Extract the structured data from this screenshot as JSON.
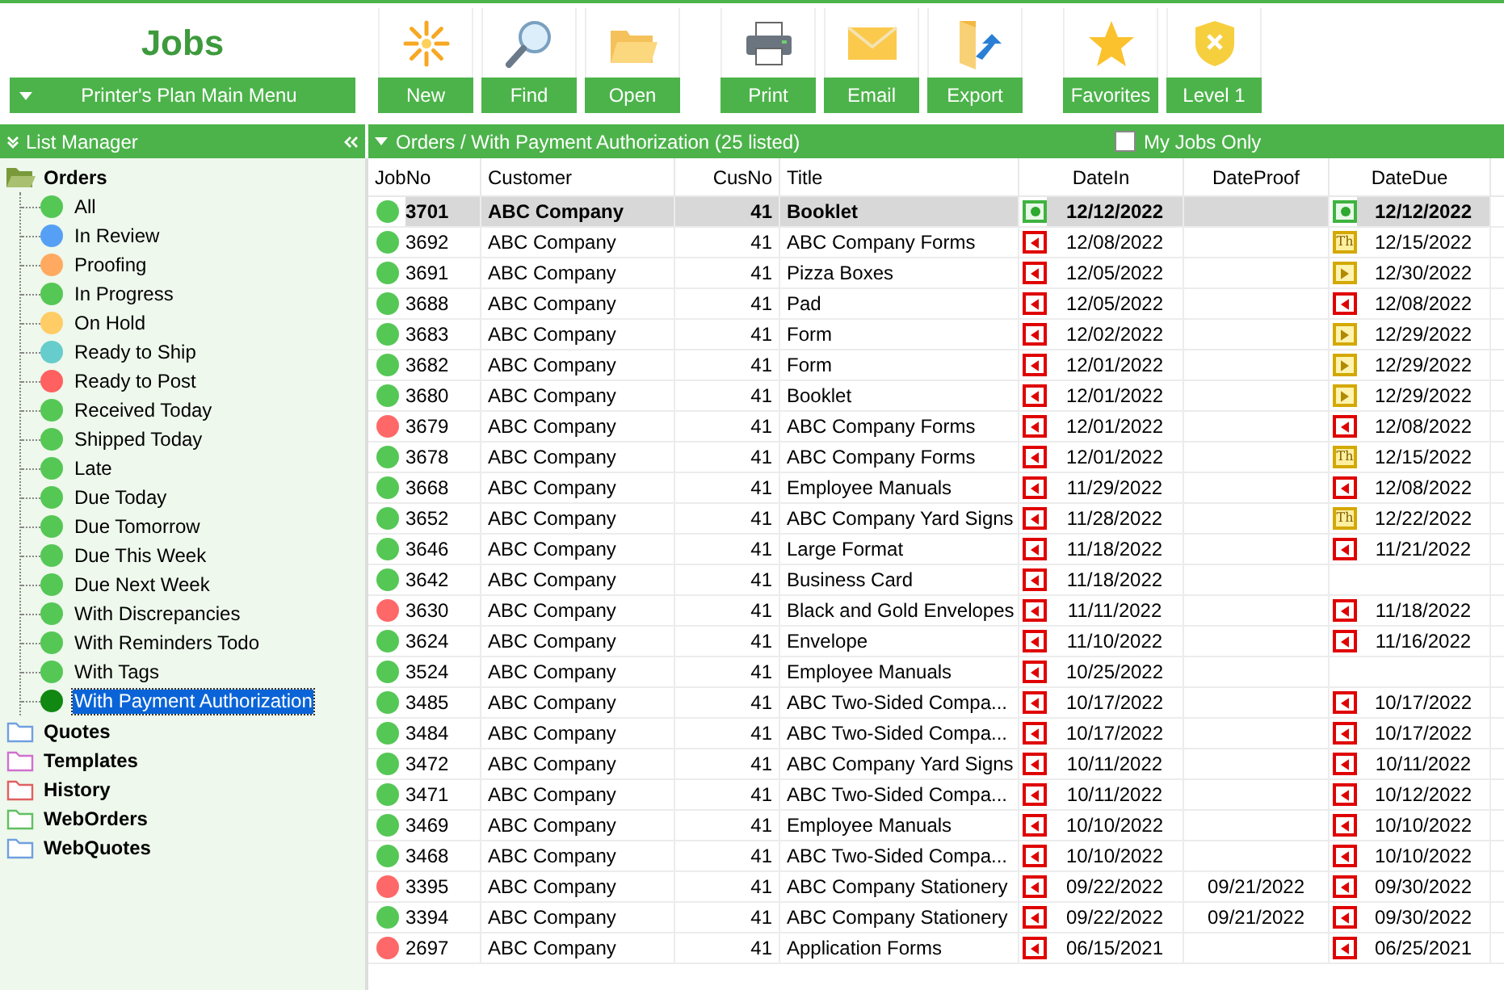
{
  "header": {
    "title": "Jobs",
    "menu": "Printer's Plan Main Menu"
  },
  "toolbar": [
    {
      "label": "New"
    },
    {
      "label": "Find"
    },
    {
      "label": "Open"
    },
    {
      "label": "Print"
    },
    {
      "label": "Email"
    },
    {
      "label": "Export"
    },
    {
      "label": "Favorites"
    },
    {
      "label": "Level 1"
    }
  ],
  "sidebar": {
    "title": "List Manager",
    "folders": [
      {
        "label": "Orders",
        "color": "#7a9a3a",
        "expanded": true,
        "children": [
          {
            "label": "All",
            "color": "#55c755",
            "selected": false
          },
          {
            "label": "In Review",
            "color": "#55a0f5",
            "selected": false
          },
          {
            "label": "Proofing",
            "color": "#ffaa60",
            "selected": false
          },
          {
            "label": "In Progress",
            "color": "#55c755",
            "selected": false
          },
          {
            "label": "On Hold",
            "color": "#ffcc66",
            "selected": false
          },
          {
            "label": "Ready to Ship",
            "color": "#66cccc",
            "selected": false
          },
          {
            "label": "Ready to Post",
            "color": "#ff6060",
            "selected": false
          },
          {
            "label": "Received Today",
            "color": "#55c755",
            "selected": false
          },
          {
            "label": "Shipped Today",
            "color": "#55c755",
            "selected": false
          },
          {
            "label": "Late",
            "color": "#55c755",
            "selected": false
          },
          {
            "label": "Due Today",
            "color": "#55c755",
            "selected": false
          },
          {
            "label": "Due Tomorrow",
            "color": "#55c755",
            "selected": false
          },
          {
            "label": "Due This Week",
            "color": "#55c755",
            "selected": false
          },
          {
            "label": "Due Next Week",
            "color": "#55c755",
            "selected": false
          },
          {
            "label": "With Discrepancies",
            "color": "#55c755",
            "selected": false
          },
          {
            "label": "With Reminders Todo",
            "color": "#55c755",
            "selected": false
          },
          {
            "label": "With Tags",
            "color": "#55c755",
            "selected": false
          },
          {
            "label": "With Payment Authorization",
            "color": "#118811",
            "selected": true
          }
        ]
      },
      {
        "label": "Quotes",
        "color": "#6fa0e0",
        "expanded": false
      },
      {
        "label": "Templates",
        "color": "#d070d0",
        "expanded": false
      },
      {
        "label": "History",
        "color": "#e06060",
        "expanded": false
      },
      {
        "label": "WebOrders",
        "color": "#60c060",
        "expanded": false
      },
      {
        "label": "WebQuotes",
        "color": "#6fa0e0",
        "expanded": false
      }
    ]
  },
  "list": {
    "path": "Orders / With Payment Authorization (25 listed)",
    "my_jobs_only": {
      "label": "My Jobs Only",
      "checked": false
    }
  },
  "table": {
    "columns": [
      "JobNo",
      "Customer",
      "CusNo",
      "Title",
      "DateIn",
      "DateProof",
      "DateDue"
    ],
    "rows": [
      {
        "selected": true,
        "color": "#55c755",
        "job": "3701",
        "customer": "ABC Company",
        "cusno": "41",
        "title": "Booklet",
        "in_flag": {
          "kind": "dot"
        },
        "date_in": "12/12/2022",
        "due_flag": {
          "kind": "dot"
        },
        "date_due": "12/12/2022"
      },
      {
        "selected": false,
        "color": "#55c755",
        "job": "3692",
        "customer": "ABC Company",
        "cusno": "41",
        "title": "ABC Company Forms",
        "in_flag": {
          "kind": "left"
        },
        "date_in": "12/08/2022",
        "due_flag": {
          "kind": "day",
          "text": "Th"
        },
        "date_due": "12/15/2022"
      },
      {
        "selected": false,
        "color": "#55c755",
        "job": "3691",
        "customer": "ABC Company",
        "cusno": "41",
        "title": "Pizza Boxes",
        "in_flag": {
          "kind": "left"
        },
        "date_in": "12/05/2022",
        "due_flag": {
          "kind": "right"
        },
        "date_due": "12/30/2022"
      },
      {
        "selected": false,
        "color": "#55c755",
        "job": "3688",
        "customer": "ABC Company",
        "cusno": "41",
        "title": "Pad",
        "in_flag": {
          "kind": "left"
        },
        "date_in": "12/05/2022",
        "due_flag": {
          "kind": "left"
        },
        "date_due": "12/08/2022"
      },
      {
        "selected": false,
        "color": "#55c755",
        "job": "3683",
        "customer": "ABC Company",
        "cusno": "41",
        "title": "Form",
        "in_flag": {
          "kind": "left"
        },
        "date_in": "12/02/2022",
        "due_flag": {
          "kind": "right"
        },
        "date_due": "12/29/2022"
      },
      {
        "selected": false,
        "color": "#55c755",
        "job": "3682",
        "customer": "ABC Company",
        "cusno": "41",
        "title": "Form",
        "in_flag": {
          "kind": "left"
        },
        "date_in": "12/01/2022",
        "due_flag": {
          "kind": "right"
        },
        "date_due": "12/29/2022"
      },
      {
        "selected": false,
        "color": "#55c755",
        "job": "3680",
        "customer": "ABC Company",
        "cusno": "41",
        "title": "Booklet",
        "in_flag": {
          "kind": "left"
        },
        "date_in": "12/01/2022",
        "due_flag": {
          "kind": "right"
        },
        "date_due": "12/29/2022"
      },
      {
        "selected": false,
        "color": "#ff6868",
        "job": "3679",
        "customer": "ABC Company",
        "cusno": "41",
        "title": "ABC Company Forms",
        "in_flag": {
          "kind": "left"
        },
        "date_in": "12/01/2022",
        "due_flag": {
          "kind": "left"
        },
        "date_due": "12/08/2022"
      },
      {
        "selected": false,
        "color": "#55c755",
        "job": "3678",
        "customer": "ABC Company",
        "cusno": "41",
        "title": "ABC Company Forms",
        "in_flag": {
          "kind": "left"
        },
        "date_in": "12/01/2022",
        "due_flag": {
          "kind": "day",
          "text": "Th"
        },
        "date_due": "12/15/2022"
      },
      {
        "selected": false,
        "color": "#55c755",
        "job": "3668",
        "customer": "ABC Company",
        "cusno": "41",
        "title": "Employee Manuals",
        "in_flag": {
          "kind": "left"
        },
        "date_in": "11/29/2022",
        "due_flag": {
          "kind": "left"
        },
        "date_due": "12/08/2022"
      },
      {
        "selected": false,
        "color": "#55c755",
        "job": "3652",
        "customer": "ABC Company",
        "cusno": "41",
        "title": "ABC Company Yard Signs",
        "in_flag": {
          "kind": "left"
        },
        "date_in": "11/28/2022",
        "due_flag": {
          "kind": "day",
          "text": "Th"
        },
        "date_due": "12/22/2022"
      },
      {
        "selected": false,
        "color": "#55c755",
        "job": "3646",
        "customer": "ABC Company",
        "cusno": "41",
        "title": "Large Format",
        "in_flag": {
          "kind": "left"
        },
        "date_in": "11/18/2022",
        "due_flag": {
          "kind": "left"
        },
        "date_due": "11/21/2022"
      },
      {
        "selected": false,
        "color": "#55c755",
        "job": "3642",
        "customer": "ABC Company",
        "cusno": "41",
        "title": "Business Card",
        "in_flag": {
          "kind": "left"
        },
        "date_in": "11/18/2022"
      },
      {
        "selected": false,
        "color": "#ff6868",
        "job": "3630",
        "customer": "ABC Company",
        "cusno": "41",
        "title": "Black and Gold Envelopes",
        "in_flag": {
          "kind": "left"
        },
        "date_in": "11/11/2022",
        "due_flag": {
          "kind": "left"
        },
        "date_due": "11/18/2022"
      },
      {
        "selected": false,
        "color": "#55c755",
        "job": "3624",
        "customer": "ABC Company",
        "cusno": "41",
        "title": "Envelope",
        "in_flag": {
          "kind": "left"
        },
        "date_in": "11/10/2022",
        "due_flag": {
          "kind": "left"
        },
        "date_due": "11/16/2022"
      },
      {
        "selected": false,
        "color": "#55c755",
        "job": "3524",
        "customer": "ABC Company",
        "cusno": "41",
        "title": "Employee Manuals",
        "in_flag": {
          "kind": "left"
        },
        "date_in": "10/25/2022"
      },
      {
        "selected": false,
        "color": "#55c755",
        "job": "3485",
        "customer": "ABC Company",
        "cusno": "41",
        "title": "ABC Two-Sided Compa...",
        "in_flag": {
          "kind": "left"
        },
        "date_in": "10/17/2022",
        "due_flag": {
          "kind": "left"
        },
        "date_due": "10/17/2022"
      },
      {
        "selected": false,
        "color": "#55c755",
        "job": "3484",
        "customer": "ABC Company",
        "cusno": "41",
        "title": "ABC Two-Sided Compa...",
        "in_flag": {
          "kind": "left"
        },
        "date_in": "10/17/2022",
        "due_flag": {
          "kind": "left"
        },
        "date_due": "10/17/2022"
      },
      {
        "selected": false,
        "color": "#55c755",
        "job": "3472",
        "customer": "ABC Company",
        "cusno": "41",
        "title": "ABC Company Yard Signs",
        "in_flag": {
          "kind": "left"
        },
        "date_in": "10/11/2022",
        "due_flag": {
          "kind": "left"
        },
        "date_due": "10/11/2022"
      },
      {
        "selected": false,
        "color": "#55c755",
        "job": "3471",
        "customer": "ABC Company",
        "cusno": "41",
        "title": "ABC Two-Sided Compa...",
        "in_flag": {
          "kind": "left"
        },
        "date_in": "10/11/2022",
        "due_flag": {
          "kind": "left"
        },
        "date_due": "10/12/2022"
      },
      {
        "selected": false,
        "color": "#55c755",
        "job": "3469",
        "customer": "ABC Company",
        "cusno": "41",
        "title": "Employee Manuals",
        "in_flag": {
          "kind": "left"
        },
        "date_in": "10/10/2022",
        "due_flag": {
          "kind": "left"
        },
        "date_due": "10/10/2022"
      },
      {
        "selected": false,
        "color": "#55c755",
        "job": "3468",
        "customer": "ABC Company",
        "cusno": "41",
        "title": "ABC Two-Sided Compa...",
        "in_flag": {
          "kind": "left"
        },
        "date_in": "10/10/2022",
        "due_flag": {
          "kind": "left"
        },
        "date_due": "10/10/2022"
      },
      {
        "selected": false,
        "color": "#ff6868",
        "job": "3395",
        "customer": "ABC Company",
        "cusno": "41",
        "title": "ABC Company Stationery",
        "in_flag": {
          "kind": "left"
        },
        "date_in": "09/22/2022",
        "date_proof": "09/21/2022",
        "due_flag": {
          "kind": "left"
        },
        "date_due": "09/30/2022"
      },
      {
        "selected": false,
        "color": "#55c755",
        "job": "3394",
        "customer": "ABC Company",
        "cusno": "41",
        "title": "ABC Company Stationery",
        "in_flag": {
          "kind": "left"
        },
        "date_in": "09/22/2022",
        "date_proof": "09/21/2022",
        "due_flag": {
          "kind": "left"
        },
        "date_due": "09/30/2022"
      },
      {
        "selected": false,
        "color": "#ff6868",
        "job": "2697",
        "customer": "ABC Company",
        "cusno": "41",
        "title": "Application Forms",
        "in_flag": {
          "kind": "left"
        },
        "date_in": "06/15/2021",
        "due_flag": {
          "kind": "left"
        },
        "date_due": "06/25/2021"
      }
    ]
  }
}
